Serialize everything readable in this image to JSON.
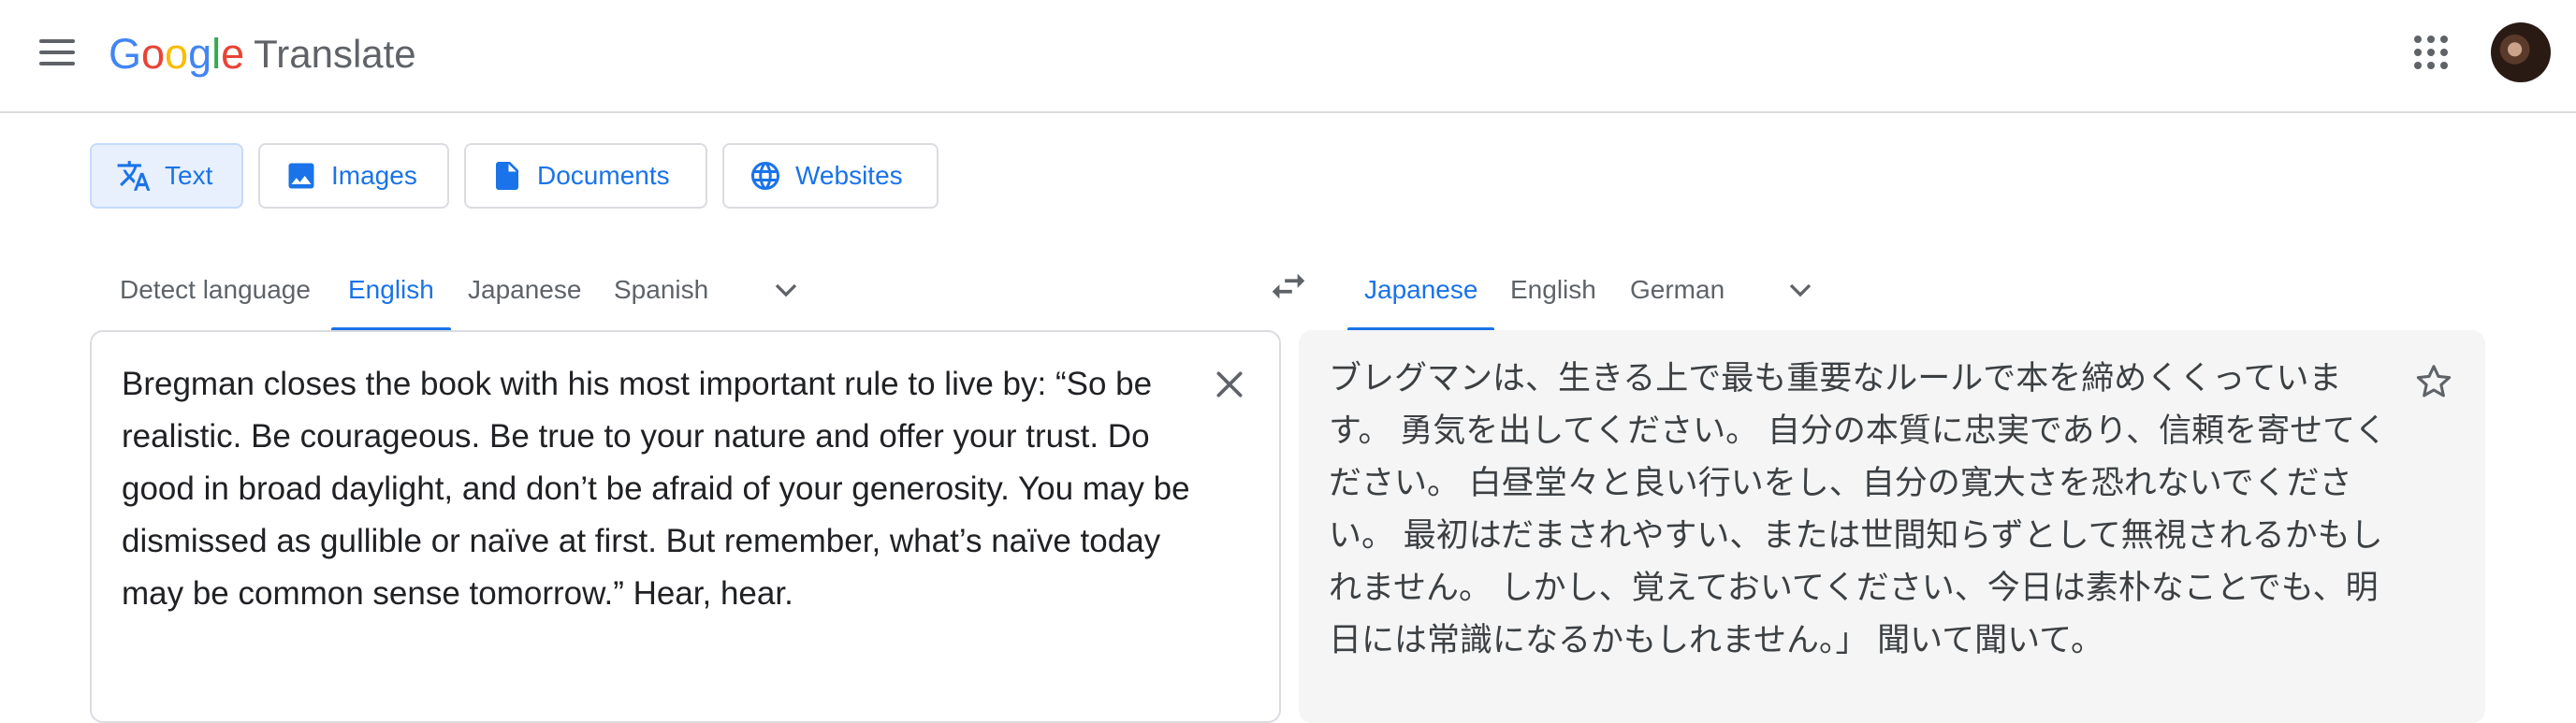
{
  "app": {
    "logo_letters": [
      {
        "ch": "G",
        "color": "#4285f4"
      },
      {
        "ch": "o",
        "color": "#ea4335"
      },
      {
        "ch": "o",
        "color": "#fbbc05"
      },
      {
        "ch": "g",
        "color": "#4285f4"
      },
      {
        "ch": "l",
        "color": "#34a853"
      },
      {
        "ch": "e",
        "color": "#ea4335"
      }
    ],
    "product_name": "Translate"
  },
  "mode_tabs": [
    {
      "label": "Text",
      "icon": "translate-icon",
      "active": true
    },
    {
      "label": "Images",
      "icon": "image-icon",
      "active": false
    },
    {
      "label": "Documents",
      "icon": "document-icon",
      "active": false
    },
    {
      "label": "Websites",
      "icon": "globe-icon",
      "active": false
    }
  ],
  "source_languages": [
    "Detect language",
    "English",
    "Japanese",
    "Spanish"
  ],
  "source_selected": "English",
  "target_languages": [
    "Japanese",
    "English",
    "German"
  ],
  "target_selected": "Japanese",
  "source_text": "Bregman closes the book with his most important rule to live by: “So be realistic. Be courageous. Be true to your nature and offer your trust. Do good in broad daylight, and don’t be afraid of your generosity. You may be dismissed as gullible or naïve at first. But remember, what’s naïve today may be common sense tomorrow.” Hear, hear.",
  "translated_text": "ブレグマンは、生きる上で最も重要なルールで本を締めくくっています。 勇気を出してください。 自分の本質に忠実であり、信頼を寄せてください。 白昼堂々と良い行いをし、自分の寛大さを恐れないでください。 最初はだまされやすい、または世間知らずとして無視されるかもしれません。 しかし、覚えておいてください、今日は素朴なことでも、明日には常識になるかもしれません。」 聞いて聞いて。",
  "colors": {
    "accent": "#1a73e8",
    "active_tab_bg": "#e8f0fe",
    "target_panel_bg": "#f5f5f5"
  }
}
